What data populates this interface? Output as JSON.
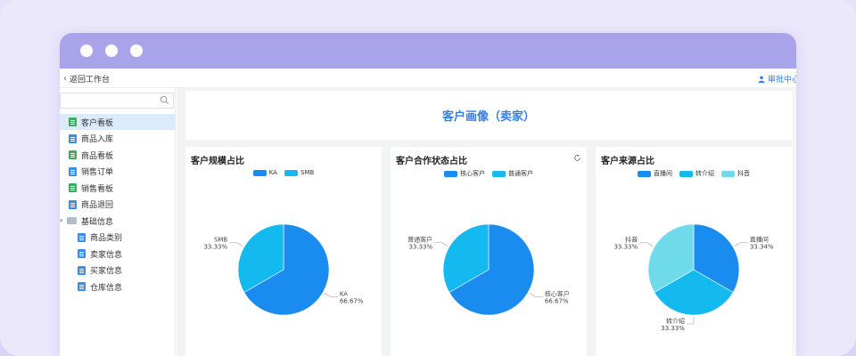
{
  "topbar": {
    "back_label": "返回工作台",
    "approval_label": "审批中心"
  },
  "sidebar": {
    "search": {
      "placeholder": "",
      "value": ""
    },
    "items": [
      {
        "label": "客户看板",
        "icon": "chart-doc-icon",
        "icon_color": "#3cae5b",
        "active": true
      },
      {
        "label": "商品入库",
        "icon": "doc-icon",
        "icon_color": "#3a8ee6",
        "active": false
      },
      {
        "label": "商品看板",
        "icon": "chart-doc-icon",
        "icon_color": "#3cae5b",
        "active": false
      },
      {
        "label": "销售订单",
        "icon": "doc-icon",
        "icon_color": "#3a8ee6",
        "active": false
      },
      {
        "label": "销售看板",
        "icon": "chart-doc-icon",
        "icon_color": "#3cae5b",
        "active": false
      },
      {
        "label": "商品退回",
        "icon": "doc-icon",
        "icon_color": "#3a8ee6",
        "active": false
      },
      {
        "label": "基础信息",
        "icon": "folder-icon",
        "expanded": true
      },
      {
        "label": "商品类别",
        "icon": "doc-icon",
        "icon_color": "#3a8ee6",
        "indent": true
      },
      {
        "label": "卖家信息",
        "icon": "doc-icon",
        "icon_color": "#3a8ee6",
        "indent": true
      },
      {
        "label": "买家信息",
        "icon": "doc-icon",
        "icon_color": "#3a8ee6",
        "indent": true
      },
      {
        "label": "仓库信息",
        "icon": "doc-icon",
        "icon_color": "#3a8ee6",
        "indent": true
      }
    ]
  },
  "main": {
    "page_title": "客户画像（卖家）"
  },
  "colors": {
    "titlebar": "#a9a4ea",
    "accent": "#2f80ed",
    "pie_primary": "#1a8cf0",
    "pie_secondary": "#14b9ef",
    "pie_tertiary": "#6fdbea"
  },
  "chart_data": [
    {
      "type": "pie",
      "title": "客户规模占比",
      "slices": [
        {
          "name": "KA",
          "value": 66.67,
          "pct_label": "66.67%",
          "color": "#1a8cf0"
        },
        {
          "name": "SMB",
          "value": 33.33,
          "pct_label": "33.33%",
          "color": "#14b9ef"
        }
      ],
      "legend_position": "top-center",
      "has_refresh": false
    },
    {
      "type": "pie",
      "title": "客户合作状态占比",
      "slices": [
        {
          "name": "核心客户",
          "value": 66.67,
          "pct_label": "66.67%",
          "color": "#1a8cf0"
        },
        {
          "name": "普通客户",
          "value": 33.33,
          "pct_label": "33.33%",
          "color": "#14b9ef"
        }
      ],
      "legend_position": "top-center",
      "has_refresh": true
    },
    {
      "type": "pie",
      "title": "客户来源占比",
      "slices": [
        {
          "name": "直播间",
          "value": 33.34,
          "pct_label": "33.34%",
          "color": "#1a8cf0"
        },
        {
          "name": "转介绍",
          "value": 33.33,
          "pct_label": "33.33%",
          "color": "#14b9ef"
        },
        {
          "name": "抖音",
          "value": 33.33,
          "pct_label": "33.33%",
          "color": "#6fdbea"
        }
      ],
      "legend_position": "top-center",
      "has_refresh": false
    }
  ]
}
